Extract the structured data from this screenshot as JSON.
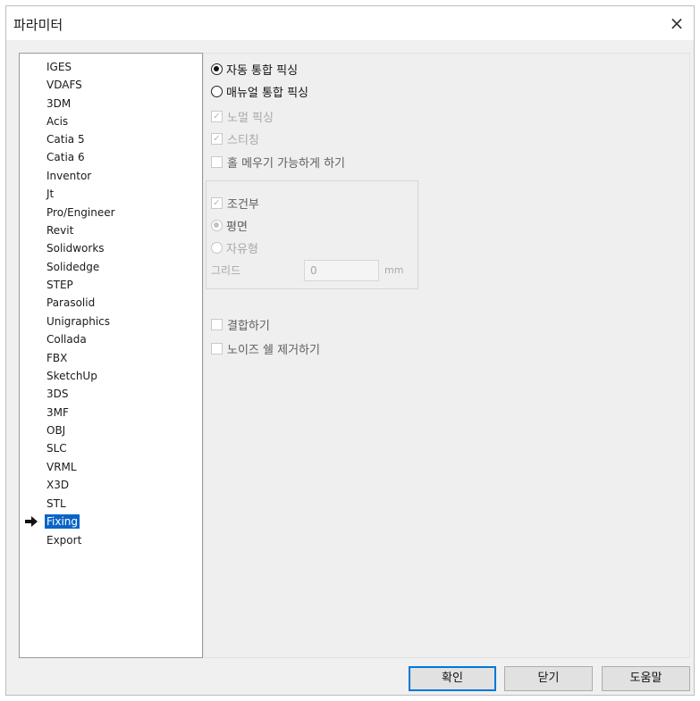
{
  "window": {
    "title": "파라미터",
    "close_symbol": "×"
  },
  "sidebar": {
    "items": [
      {
        "label": "IGES"
      },
      {
        "label": "VDAFS"
      },
      {
        "label": "3DM"
      },
      {
        "label": "Acis"
      },
      {
        "label": "Catia 5"
      },
      {
        "label": "Catia 6"
      },
      {
        "label": "Inventor"
      },
      {
        "label": "Jt"
      },
      {
        "label": "Pro/Engineer"
      },
      {
        "label": "Revit"
      },
      {
        "label": "Solidworks"
      },
      {
        "label": "Solidedge"
      },
      {
        "label": "STEP"
      },
      {
        "label": "Parasolid"
      },
      {
        "label": "Unigraphics"
      },
      {
        "label": "Collada"
      },
      {
        "label": "FBX"
      },
      {
        "label": "SketchUp"
      },
      {
        "label": "3DS"
      },
      {
        "label": "3MF"
      },
      {
        "label": "OBJ"
      },
      {
        "label": "SLC"
      },
      {
        "label": "VRML"
      },
      {
        "label": "X3D"
      },
      {
        "label": "STL"
      },
      {
        "label": "Fixing"
      },
      {
        "label": "Export"
      }
    ],
    "selected": "Fixing",
    "arrow_icon": "right-arrow-icon"
  },
  "options": {
    "auto_fix": "자동 통합 픽싱",
    "manual_fix": "매뉴얼 통합 픽싱",
    "normal_fix": "노멀 픽싱",
    "stitching": "스티칭",
    "hole_fill": "홀 메우기 가능하게 하기",
    "conditional": "조건부",
    "flat": "평면",
    "freeform": "자유형",
    "grid_label": "그리드",
    "grid_value": "0",
    "grid_unit": "mm",
    "merge": "결합하기",
    "noise_remove": "노이즈 쉘 제거하기"
  },
  "buttons": {
    "ok": "확인",
    "close": "닫기",
    "help": "도움말"
  },
  "colors": {
    "selection": "#0a64c8",
    "default_button_border": "#0078d7"
  }
}
